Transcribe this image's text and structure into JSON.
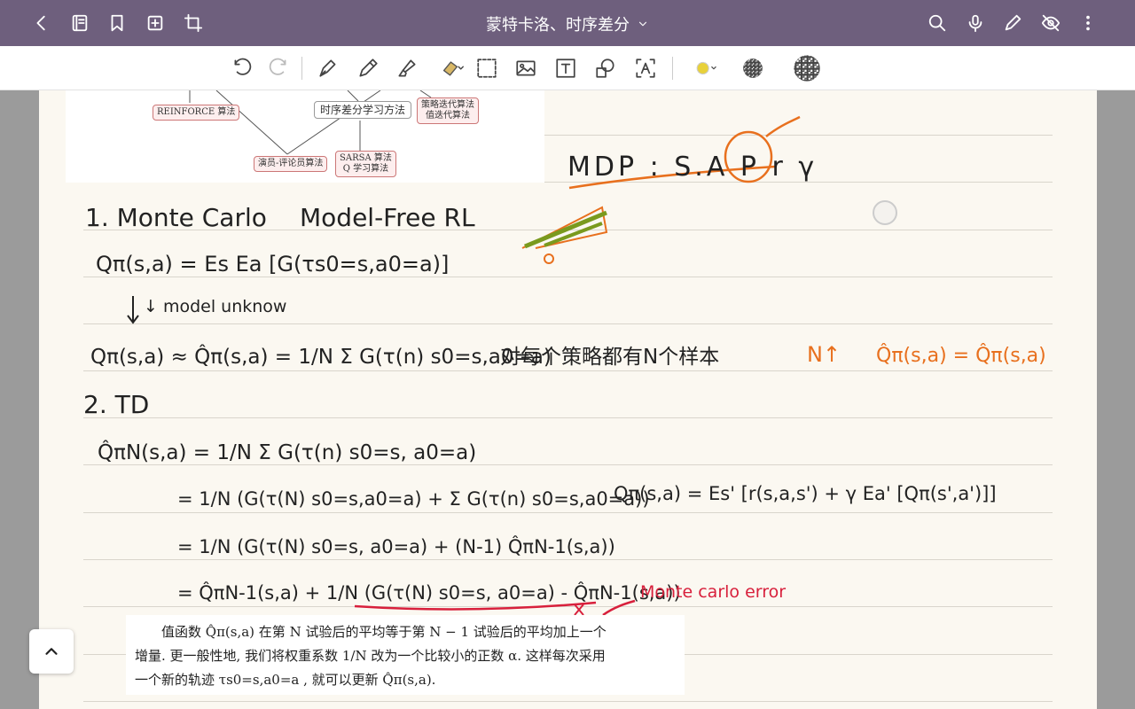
{
  "titlebar": {
    "title": "蒙特卡洛、时序差分",
    "icons": [
      "back-icon",
      "book-icon",
      "bookmark-icon",
      "add-page-icon",
      "crop-icon",
      "search-icon",
      "mic-icon",
      "pen-icon",
      "hide-icon",
      "more-icon"
    ]
  },
  "toolbar": {
    "tools": [
      "undo",
      "redo",
      "fountain-pen",
      "pencil",
      "highlighter",
      "eraser",
      "lasso",
      "image",
      "text",
      "shapes",
      "text-recognition",
      "color-yellow",
      "pattern-1",
      "pattern-2"
    ],
    "accent_color": "#e8d13a"
  },
  "diagram": {
    "reinforce": "REINFORCE 算法",
    "td_method": "时序差分学习方法",
    "policy_iter": "策略迭代算法",
    "value_iter": "值迭代算法",
    "actor_critic": "演员-评论员算法",
    "sarsa": "SARSA 算法",
    "qlearning": "Q 学习算法"
  },
  "notes": {
    "mdp": "MDP : S.A P r γ",
    "mc_heading": "1. Monte Carlo",
    "model_free": "Model-Free RL",
    "eq1": "Qπ(s,a) = Es Ea [G(τs0=s,a0=a)]",
    "model_unknow": "↓ model unknow",
    "eq2": "Qπ(s,a) ≈ Q̂π(s,a) = 1/N Σ G(τ(n) s0=s,a0=a)",
    "eq2_note": "对每个策略都有N个样本",
    "n_up": "N↑",
    "n_up_eq": "Q̂π(s,a) = Q̂π(s,a)",
    "td_heading": "2. TD",
    "eq3": "Q̂πN(s,a) = 1/N Σ G(τ(n) s0=s, a0=a)",
    "eq4": "= 1/N (G(τ(N) s0=s,a0=a) + Σ G(τ(n) s0=s,a0=a))",
    "bellman": "Qπ(s,a) = Es' [r(s,a,s') + γ Ea' [Qπ(s',a')]]",
    "eq5": "= 1/N (G(τ(N) s0=s, a0=a) + (N-1) Q̂πN-1(s,a))",
    "eq6": "= Q̂πN-1(s,a) + 1/N (G(τ(N) s0=s, a0=a) - Q̂πN-1(s,a))",
    "mc_error": "Monte carlo error"
  },
  "textbook": {
    "line1": "值函数 Q̂π(s,a) 在第 N 试验后的平均等于第 N − 1 试验后的平均加上一个",
    "line2": "增量. 更一般性地, 我们将权重系数 1/N 改为一个比较小的正数 α. 这样每次采用",
    "line3": "一个新的轨迹 τs0=s,a0=a , 就可以更新 Q̂π(s,a)."
  }
}
